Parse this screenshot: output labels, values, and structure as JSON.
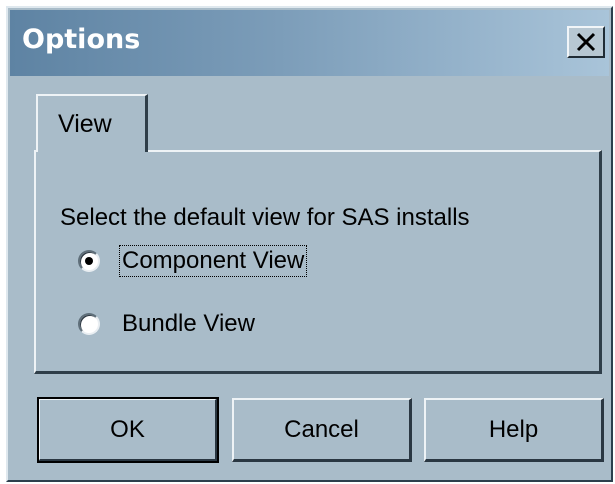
{
  "window": {
    "title": "Options",
    "close_label": "X"
  },
  "tabs": [
    {
      "label": "View",
      "active": true
    }
  ],
  "view_panel": {
    "instruction": "Select the default view for SAS installs",
    "options": [
      {
        "label": "Component View",
        "selected": true
      },
      {
        "label": "Bundle View",
        "selected": false
      }
    ]
  },
  "buttons": {
    "ok": "OK",
    "cancel": "Cancel",
    "help": "Help"
  },
  "colors": {
    "face": "#a9bcc9",
    "title_gradient_start": "#5e83a3",
    "title_gradient_end": "#a9c4d9",
    "title_text": "#ffffff"
  },
  "icons": {
    "close": "close-icon"
  }
}
